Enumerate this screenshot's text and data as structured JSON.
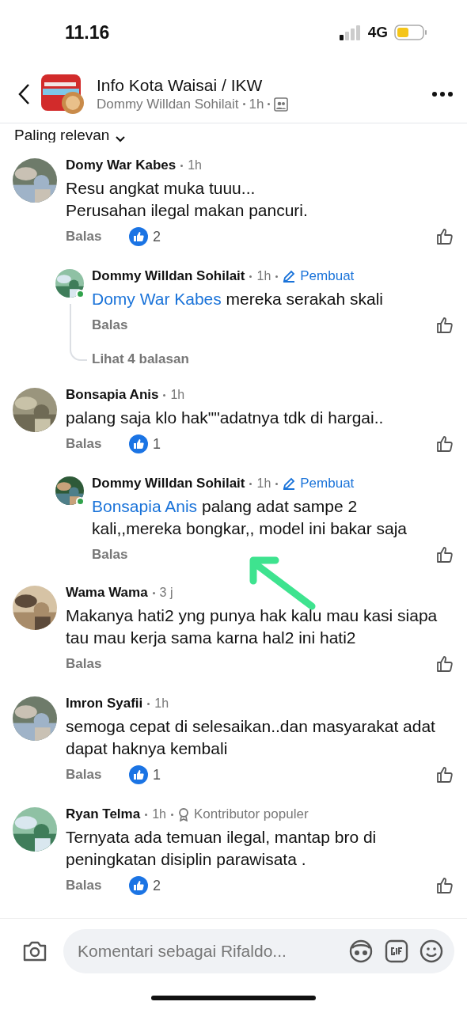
{
  "status_bar": {
    "time": "11.16",
    "network": "4G"
  },
  "header": {
    "group_name": "Info Kota Waisai / IKW",
    "author": "Dommy Willdan Sohilait",
    "time": "1h"
  },
  "sort": {
    "label": "Paling relevan"
  },
  "comments": [
    {
      "kind": "comment",
      "author": "Domy War Kabes",
      "time": "1h",
      "text": "Resu angkat muka tuuu...\nPerusahan ilegal makan pancuri.",
      "reply_label": "Balas",
      "likes": "2"
    },
    {
      "kind": "reply",
      "author": "Dommy Willdan Sohilait",
      "time": "1h",
      "online": true,
      "badge": {
        "kind": "author",
        "label": "Pembuat"
      },
      "mention": "Domy War Kabes",
      "text": "mereka serakah skali",
      "reply_label": "Balas",
      "more_replies": "Lihat 4 balasan"
    },
    {
      "kind": "comment",
      "author": "Bonsapia Anis",
      "time": "1h",
      "text": "palang saja klo hak\"\"adatnya tdk di hargai..",
      "reply_label": "Balas",
      "likes": "1"
    },
    {
      "kind": "reply",
      "author": "Dommy Willdan Sohilait",
      "time": "1h",
      "online": true,
      "badge": {
        "kind": "author",
        "label": "Pembuat"
      },
      "mention": "Bonsapia Anis",
      "text": "palang adat sampe 2 kali,,mereka bongkar,, model ini bakar saja",
      "reply_label": "Balas"
    },
    {
      "kind": "comment",
      "author": "Wama Wama",
      "time": "3 j",
      "text": "Makanya hati2 yng punya hak kalu mau kasi siapa tau mau kerja sama karna hal2 ini hati2",
      "reply_label": "Balas"
    },
    {
      "kind": "comment",
      "author": "Imron Syafii",
      "time": "1h",
      "text": "semoga cepat di selesaikan..dan masyarakat adat dapat haknya kembali",
      "reply_label": "Balas",
      "likes": "1"
    },
    {
      "kind": "comment",
      "author": "Ryan Telma",
      "time": "1h",
      "badge": {
        "kind": "popular",
        "label": "Kontributor populer"
      },
      "text": "Ternyata ada temuan ilegal, mantap bro di peningkatan disiplin parawisata .",
      "reply_label": "Balas",
      "likes": "2"
    }
  ],
  "composer": {
    "placeholder": "Komentari sebagai Rifaldo..."
  }
}
